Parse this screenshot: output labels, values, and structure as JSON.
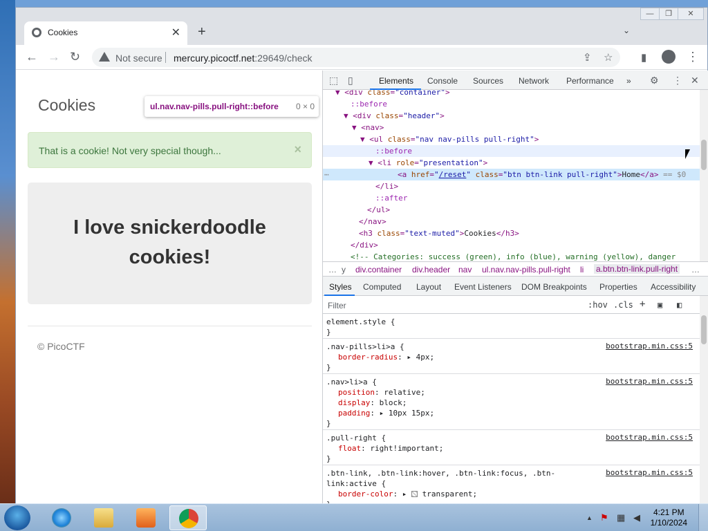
{
  "browser": {
    "tab_title": "Cookies",
    "tab_close": "✕",
    "new_tab": "+",
    "tab_search": "⌄",
    "window_buttons": [
      "—",
      "❐",
      "✕"
    ],
    "back": "←",
    "forward": "→",
    "reload": "↻",
    "not_secure": "Not secure",
    "url_host": "mercury.picoctf.net",
    "url_path": ":29649/check",
    "share_icon": "⇪",
    "star_icon": "☆",
    "sidepanel_icon": "▮",
    "menu_icon": "⋮"
  },
  "page": {
    "title": "Cookies",
    "tooltip_selector": "ul.nav.nav-pills.pull-right::before",
    "tooltip_size": "0 × 0",
    "alert_text": "That is a cookie! Not very special though...",
    "alert_close": "×",
    "jumbo_line1": "I love snickerdoodle",
    "jumbo_line2": "cookies!",
    "footer": "© PicoCTF"
  },
  "devtools": {
    "tabs": [
      "Elements",
      "Console",
      "Sources",
      "Network",
      "Performance",
      "»"
    ],
    "dom": [
      {
        "indent": 2,
        "arrow": "▼",
        "html": "<div class=\"container\">"
      },
      {
        "indent": 3,
        "arrow": "",
        "pseudo": "::before"
      },
      {
        "indent": 3,
        "arrow": "▼",
        "html": "<div class=\"header\">"
      },
      {
        "indent": 4,
        "arrow": "▼",
        "html": "<nav>"
      },
      {
        "indent": 5,
        "arrow": "▼",
        "html": "<ul class=\"nav nav-pills pull-right\">"
      },
      {
        "indent": 6,
        "arrow": "",
        "pseudo": "::before"
      },
      {
        "indent": 6,
        "arrow": "▼",
        "html": "<li role=\"presentation\">"
      },
      {
        "indent": 7,
        "arrow": "",
        "html": "<a href=\"/reset\" class=\"btn btn-link pull-right\">Home</a>",
        "suffix": " == $0"
      },
      {
        "indent": 6,
        "arrow": "",
        "html": "</li>"
      },
      {
        "indent": 6,
        "arrow": "",
        "pseudo": "::after"
      },
      {
        "indent": 5,
        "arrow": "",
        "html": "</ul>"
      },
      {
        "indent": 4,
        "arrow": "",
        "html": "</nav>"
      },
      {
        "indent": 4,
        "arrow": "",
        "html": "<h3 class=\"text-muted\">Cookies</h3>"
      },
      {
        "indent": 3,
        "arrow": "",
        "html": "</div>"
      },
      {
        "indent": 3,
        "arrow": "",
        "comment": "<!-- Categories: success (green), info (blue), warning (yellow), danger"
      }
    ],
    "crumbs": [
      "…",
      "y",
      "div.container",
      "div.header",
      "nav",
      "ul.nav.nav-pills.pull-right",
      "li",
      "a.btn.btn-link.pull-right",
      "…"
    ],
    "sub_tabs": [
      "Styles",
      "Computed",
      "Layout",
      "Event Listeners",
      "DOM Breakpoints",
      "Properties",
      "Accessibility"
    ],
    "filter_placeholder": "Filter",
    "filter_hov": ":hov",
    "filter_cls": ".cls",
    "filter_plus": "+",
    "rules": [
      {
        "selector": "element.style {",
        "source": "",
        "props": []
      },
      {
        "selector": ".nav-pills>li>a {",
        "source": "bootstrap.min.css:5",
        "props": [
          {
            "name": "border-radius",
            "value": "4px",
            "arrow": true
          }
        ]
      },
      {
        "selector": ".nav>li>a {",
        "source": "bootstrap.min.css:5",
        "props": [
          {
            "name": "position",
            "value": "relative"
          },
          {
            "name": "display",
            "value": "block"
          },
          {
            "name": "padding",
            "value": "10px 15px",
            "arrow": true
          }
        ]
      },
      {
        "selector": ".pull-right {",
        "source": "bootstrap.min.css:5",
        "props": [
          {
            "name": "float",
            "value": "right!important"
          }
        ]
      },
      {
        "selector": ".btn-link, .btn-link:hover, .btn-link:focus, .btn-",
        "selector2": "link:active {",
        "source": "bootstrap.min.css:5",
        "props": [
          {
            "name": "border-color",
            "value": "transparent",
            "arrow": true,
            "swatch": true
          }
        ]
      }
    ]
  },
  "taskbar": {
    "time": "4:21 PM",
    "date": "1/10/2024",
    "tray_up": "▲"
  }
}
